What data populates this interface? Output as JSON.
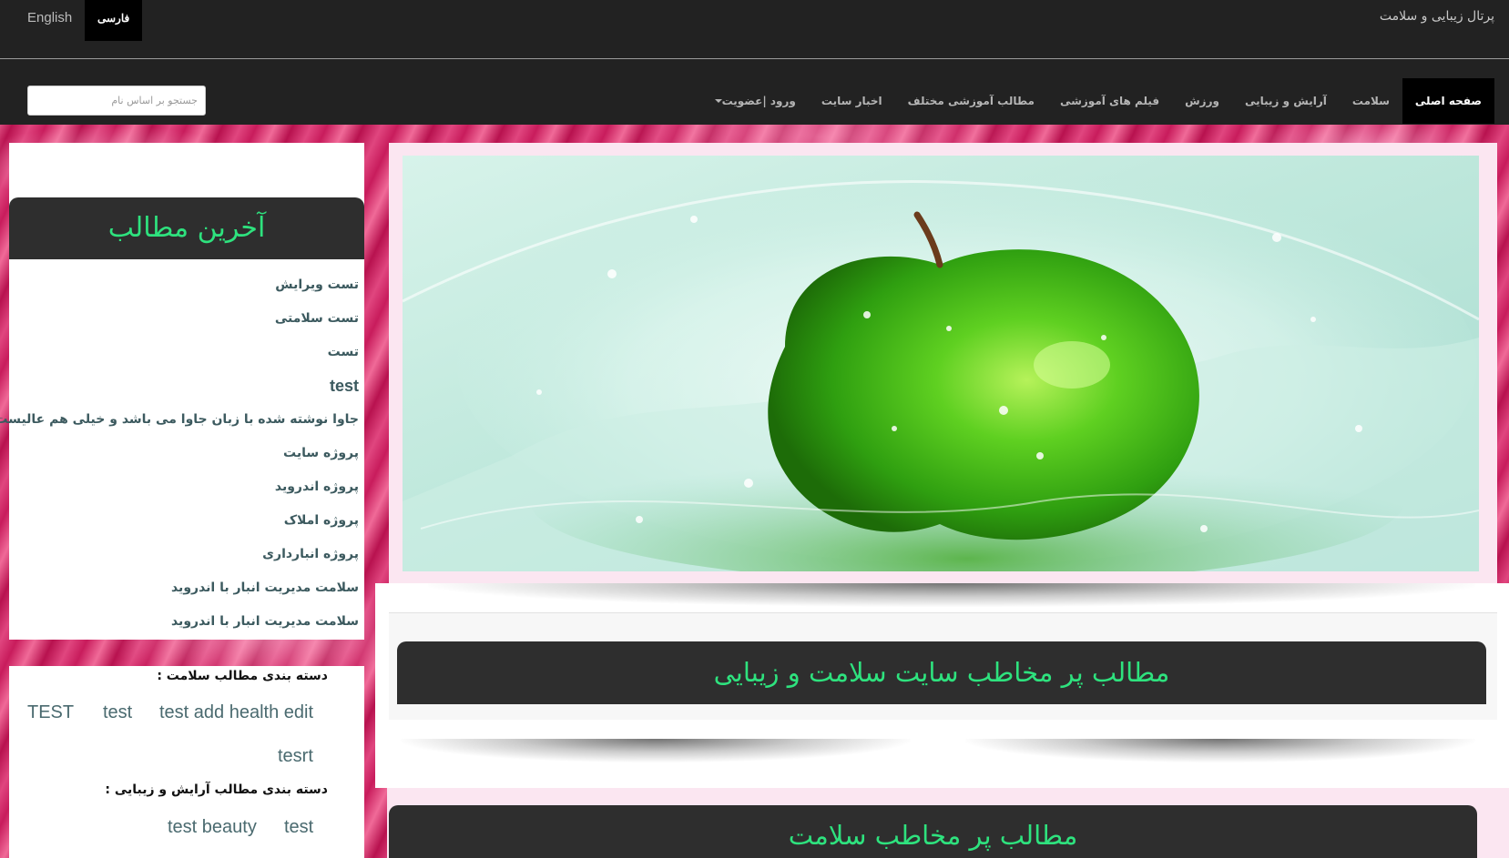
{
  "header": {
    "languages": [
      {
        "label": "English",
        "active": false
      },
      {
        "label": "فارسی",
        "active": true
      }
    ],
    "site_title": "پرتال زیبایی و سلامت",
    "search_placeholder": "جستجو بر اساس نام",
    "nav_items": [
      {
        "label": "صفحه اصلی",
        "active": true
      },
      {
        "label": "سلامت"
      },
      {
        "label": "آرایش و زیبایی"
      },
      {
        "label": "ورزش"
      },
      {
        "label": "فیلم های آموزشی"
      },
      {
        "label": "مطالب آموزشی مختلف"
      },
      {
        "label": "اخبار سایت"
      },
      {
        "label": "ورود |عضویت",
        "has_caret": true
      }
    ]
  },
  "sidebar": {
    "latest_title": "آخرین مطالب",
    "latest_items": [
      "تست ویرایش",
      "تست سلامتی",
      "تست",
      "test",
      "جاوا نوشته شده با زبان جاوا می باشد و خیلی هم عالیست",
      "پروژه سایت",
      "پروژه اندروید",
      "پروژه املاک",
      "پروژه انبارداری",
      "سلامت مدیریت انبار با اندروید",
      "سلامت مدیریت انبار با اندروید"
    ],
    "health_category_title": "دسته بندی مطالب سلامت :",
    "health_tags": [
      "TEST",
      "test",
      "test add health edit",
      "tesrt"
    ],
    "beauty_category_title": "دسته بندی مطالب آرایش و زیبایی :",
    "beauty_tags": [
      "test beauty",
      "test"
    ]
  },
  "main": {
    "slider_image_alt": "green-apple-water-splash",
    "popular_title": "مطالب پر مخاطب سایت سلامت و زیبایی",
    "health_popular_title": "مطالب پر مخاطب سلامت"
  },
  "colors": {
    "topbar": "#222222",
    "accent_green": "#2ee27e",
    "header_box": "#2e2e2e",
    "link_text": "#3c5a5f",
    "pink_frame": "#fbe6f1"
  }
}
